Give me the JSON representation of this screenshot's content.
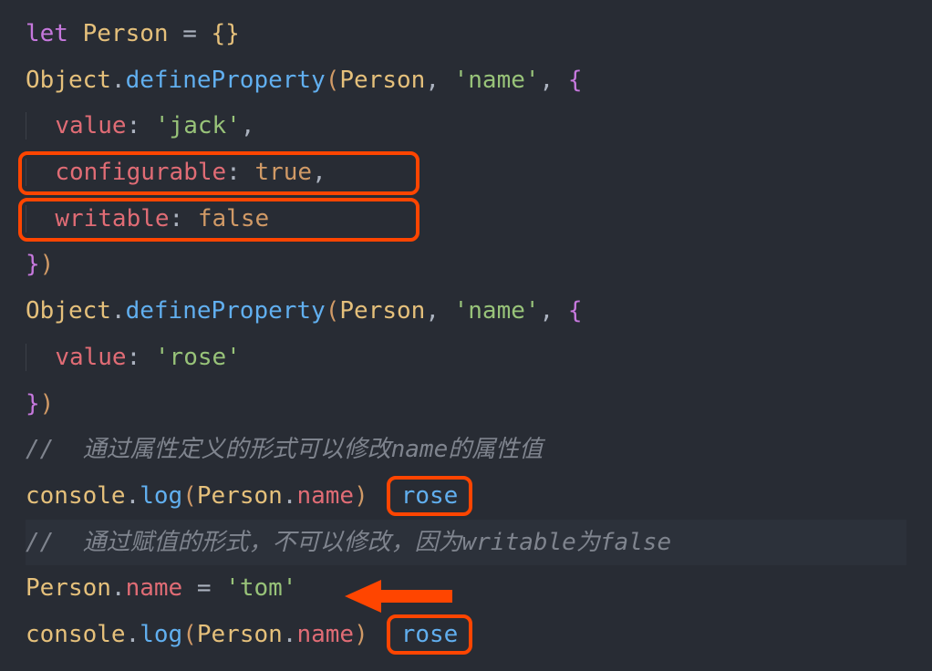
{
  "line1": {
    "let": "let",
    "person": "Person",
    "assign": " = ",
    "lbrace": "{",
    "rbrace": "}"
  },
  "line2": {
    "object": "Object",
    "dot": ".",
    "method": "defineProperty",
    "lparen": "(",
    "arg1": "Person",
    "comma1": ", ",
    "arg2": "'name'",
    "comma2": ", ",
    "lbrace": "{"
  },
  "line3": {
    "indent": "  ",
    "prop": "value",
    "colon": ": ",
    "val": "'jack'",
    "comma": ","
  },
  "line4": {
    "indent": "  ",
    "prop": "configurable",
    "colon": ": ",
    "val": "true",
    "comma": ","
  },
  "line5": {
    "indent": "  ",
    "prop": "writable",
    "colon": ": ",
    "val": "false"
  },
  "line6": {
    "rbrace": "}",
    "rparen": ")"
  },
  "line7": {
    "object": "Object",
    "dot": ".",
    "method": "defineProperty",
    "lparen": "(",
    "arg1": "Person",
    "comma1": ", ",
    "arg2": "'name'",
    "comma2": ", ",
    "lbrace": "{"
  },
  "line8": {
    "indent": "  ",
    "prop": "value",
    "colon": ": ",
    "val": "'rose'"
  },
  "line9": {
    "rbrace": "}",
    "rparen": ")"
  },
  "line10": {
    "comment": "//  通过属性定义的形式可以修改name的属性值"
  },
  "line11": {
    "console": "console",
    "dot1": ".",
    "log": "log",
    "lparen": "(",
    "person": "Person",
    "dot2": ".",
    "prop": "name",
    "rparen": ")",
    "output": "rose"
  },
  "line12": {
    "comment": "//  通过赋值的形式，不可以修改，因为writable为false"
  },
  "line13": {
    "person": "Person",
    "dot": ".",
    "prop": "name",
    "assign": " = ",
    "val": "'tom'"
  },
  "line14": {
    "console": "console",
    "dot1": ".",
    "log": "log",
    "lparen": "(",
    "person": "Person",
    "dot2": ".",
    "prop": "name",
    "rparen": ")",
    "output": "rose"
  }
}
